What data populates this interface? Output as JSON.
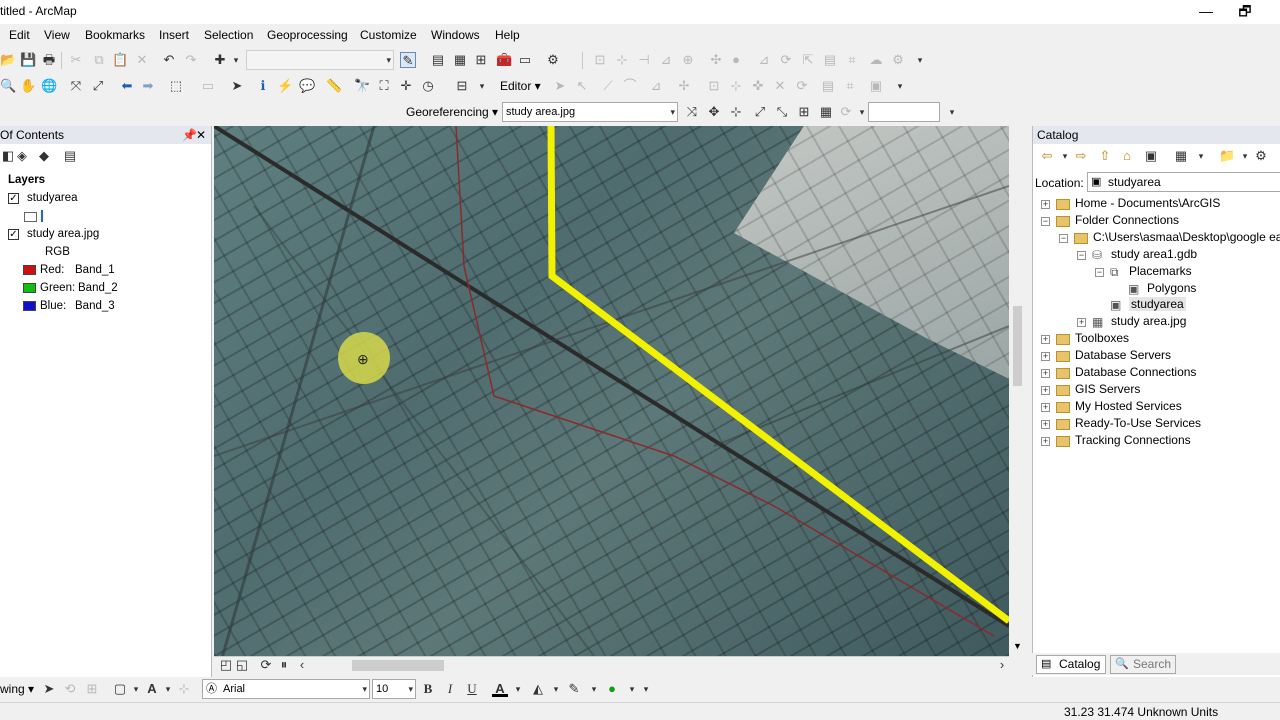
{
  "window": {
    "title": "titled - ArcMap",
    "minimize": "—",
    "restore": "🗗"
  },
  "menu": [
    "Edit",
    "View",
    "Bookmarks",
    "Insert",
    "Selection",
    "Geoprocessing",
    "Customize",
    "Windows",
    "Help"
  ],
  "toolbar3": {
    "georef_label": "Georeferencing ▾",
    "layer_combo": "study area.jpg",
    "editor_label": "Editor ▾"
  },
  "toc": {
    "title": "Of Contents",
    "layers_label": "Layers",
    "layer1": "studyarea",
    "layer2": "study area.jpg",
    "rgb": "RGB",
    "bands": [
      {
        "label": "Red:",
        "band": "Band_1",
        "color": "#d01010"
      },
      {
        "label": "Green:",
        "band": "Band_2",
        "color": "#10c010"
      },
      {
        "label": "Blue:",
        "band": "Band_3",
        "color": "#1010c8"
      }
    ]
  },
  "catalog": {
    "title": "Catalog",
    "location_label": "Location:",
    "location_value": "studyarea",
    "tree": [
      {
        "label": "Home - Documents\\ArcGIS",
        "indent": 0,
        "toggle": "+"
      },
      {
        "label": "Folder Connections",
        "indent": 0,
        "toggle": "−"
      },
      {
        "label": "C:\\Users\\asmaa\\Desktop\\google ea",
        "indent": 1,
        "toggle": "−"
      },
      {
        "label": "study area1.gdb",
        "indent": 2,
        "toggle": "−"
      },
      {
        "label": "Placemarks",
        "indent": 3,
        "toggle": "−"
      },
      {
        "label": "Polygons",
        "indent": 4,
        "toggle": ""
      },
      {
        "label": "studyarea",
        "indent": 3,
        "toggle": ""
      },
      {
        "label": "study area.jpg",
        "indent": 2,
        "toggle": "+"
      },
      {
        "label": "Toolboxes",
        "indent": 0,
        "toggle": "+"
      },
      {
        "label": "Database Servers",
        "indent": 0,
        "toggle": "+"
      },
      {
        "label": "Database Connections",
        "indent": 0,
        "toggle": "+"
      },
      {
        "label": "GIS Servers",
        "indent": 0,
        "toggle": "+"
      },
      {
        "label": "My Hosted Services",
        "indent": 0,
        "toggle": "+"
      },
      {
        "label": "Ready-To-Use Services",
        "indent": 0,
        "toggle": "+"
      },
      {
        "label": "Tracking Connections",
        "indent": 0,
        "toggle": "+"
      }
    ],
    "tab_catalog": "Catalog",
    "tab_search": "Search"
  },
  "drawing": {
    "label": "wing ▾",
    "font": "Arial",
    "size": "10",
    "bold": "B",
    "italic": "I",
    "underline": "U",
    "font_color": "A"
  },
  "status": {
    "coords": "31.23  31.474 Unknown Units"
  },
  "colors": {
    "highlight_line": "#f2f200",
    "boundary": "#8b2a2a",
    "cursor_halo": "#d6d84a"
  }
}
